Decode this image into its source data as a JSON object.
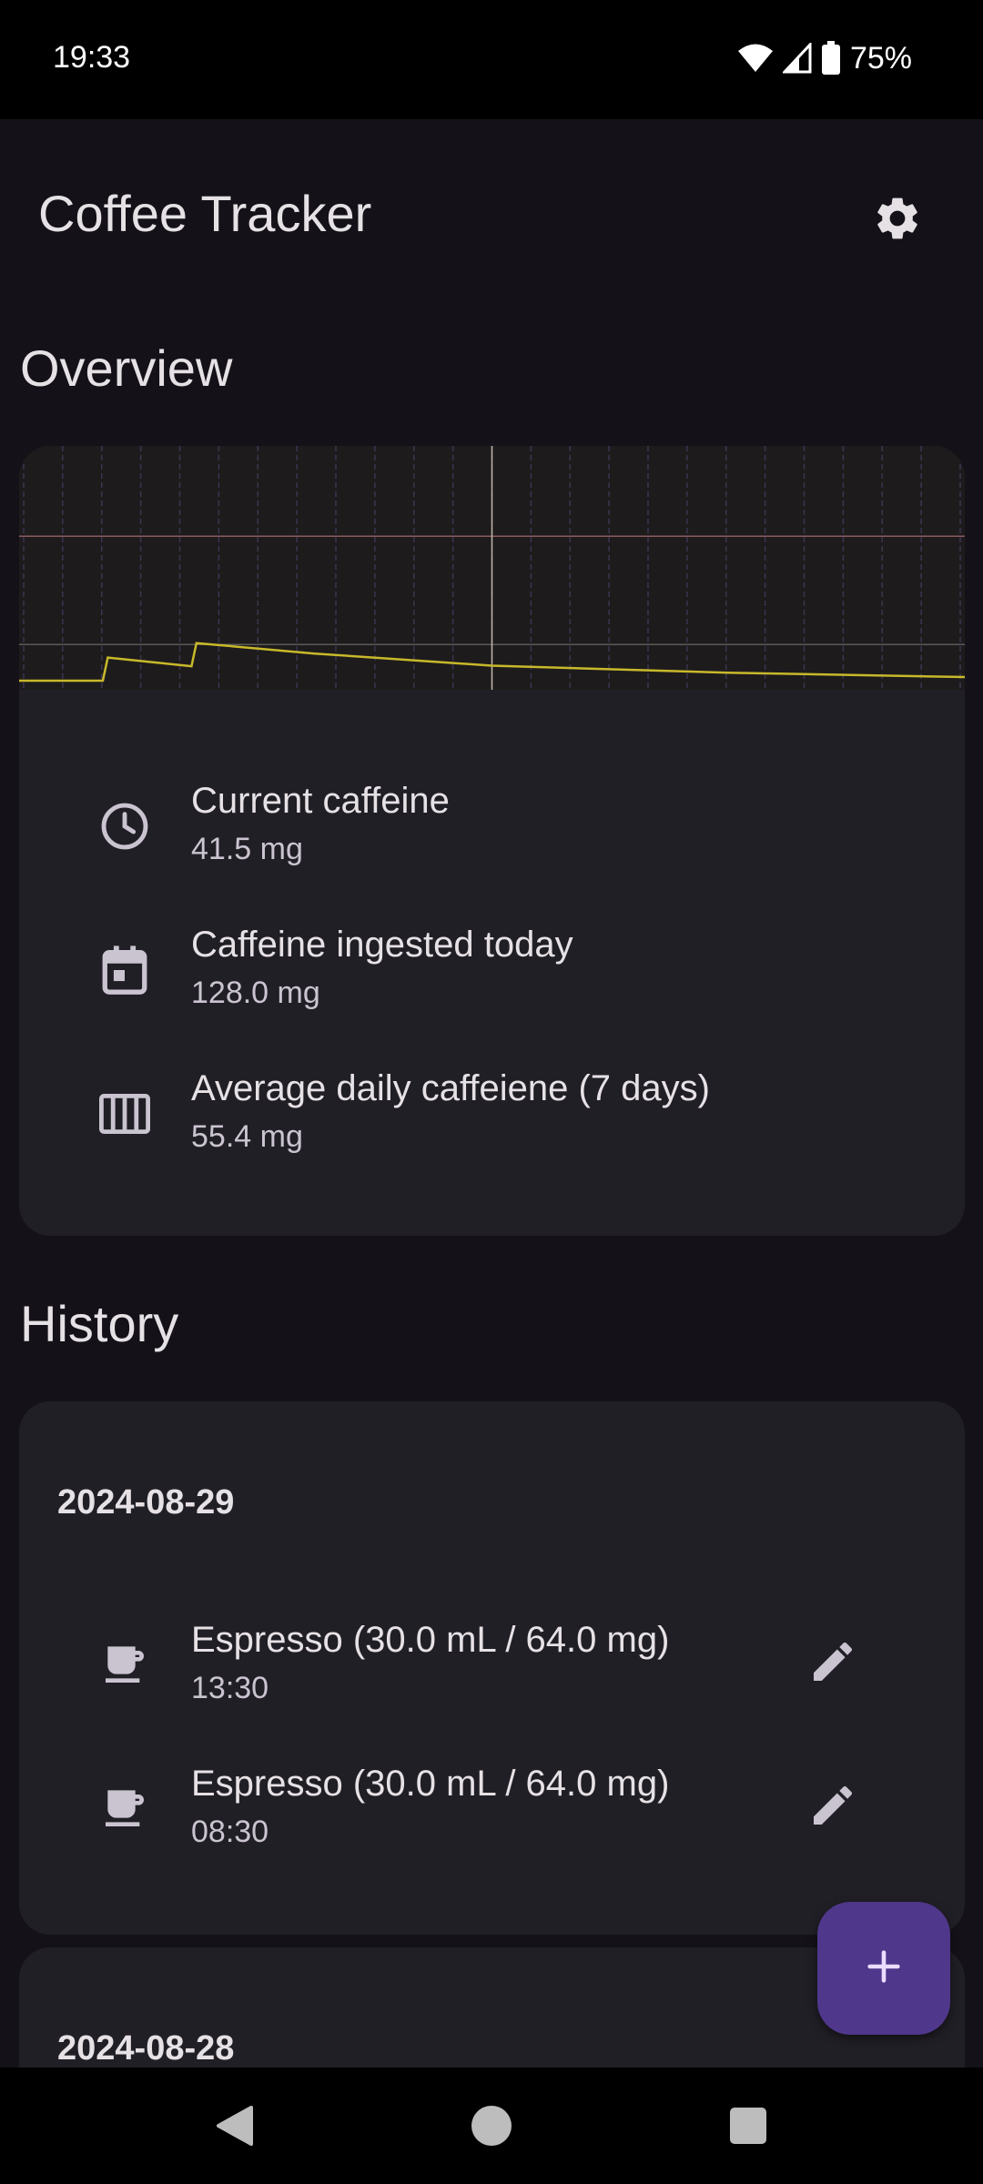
{
  "status_bar": {
    "time": "19:33",
    "battery": "75%"
  },
  "app_bar": {
    "title": "Coffee Tracker",
    "settings_icon": "gear-icon"
  },
  "overview": {
    "title": "Overview",
    "stats": [
      {
        "icon": "clock-icon",
        "label": "Current caffeine",
        "value": "41.5 mg"
      },
      {
        "icon": "calendar-icon",
        "label": "Caffeine ingested today",
        "value": "128.0 mg"
      },
      {
        "icon": "columns-icon",
        "label": "Average daily caffeiene (7 days)",
        "value": "55.4 mg"
      }
    ]
  },
  "history": {
    "title": "History",
    "groups": [
      {
        "date": "2024-08-29",
        "entries": [
          {
            "icon": "coffee-cup-icon",
            "title": "Espresso (30.0 mL / 64.0 mg)",
            "time": "13:30"
          },
          {
            "icon": "coffee-cup-icon",
            "title": "Espresso (30.0 mL / 64.0 mg)",
            "time": "08:30"
          }
        ]
      },
      {
        "date": "2024-08-28",
        "entries": []
      }
    ]
  },
  "fab": {
    "icon": "plus-icon"
  },
  "colors": {
    "background": "#141218",
    "card": "#211f26",
    "chart_bg": "#1e1b1c",
    "caffeine_line": "#c8b92a",
    "limit_line": "#8a5a5f",
    "fab": "#4f378b"
  },
  "chart_data": {
    "type": "line",
    "title": "",
    "xlabel": "",
    "ylabel": "",
    "series": [
      {
        "x": [
          0,
          8.5,
          9,
          17.5,
          18,
          30,
          48,
          72,
          96
        ],
        "values": [
          0,
          0,
          64,
          40,
          104,
          75,
          41.5,
          22,
          10
        ]
      }
    ],
    "reference_lines": [
      {
        "axis": "y",
        "value": 400
      },
      {
        "axis": "y",
        "value": 100
      },
      {
        "axis": "x",
        "value": 48
      }
    ],
    "ylim": [
      0,
      650
    ],
    "xlim": [
      0,
      96
    ],
    "grid": true
  }
}
